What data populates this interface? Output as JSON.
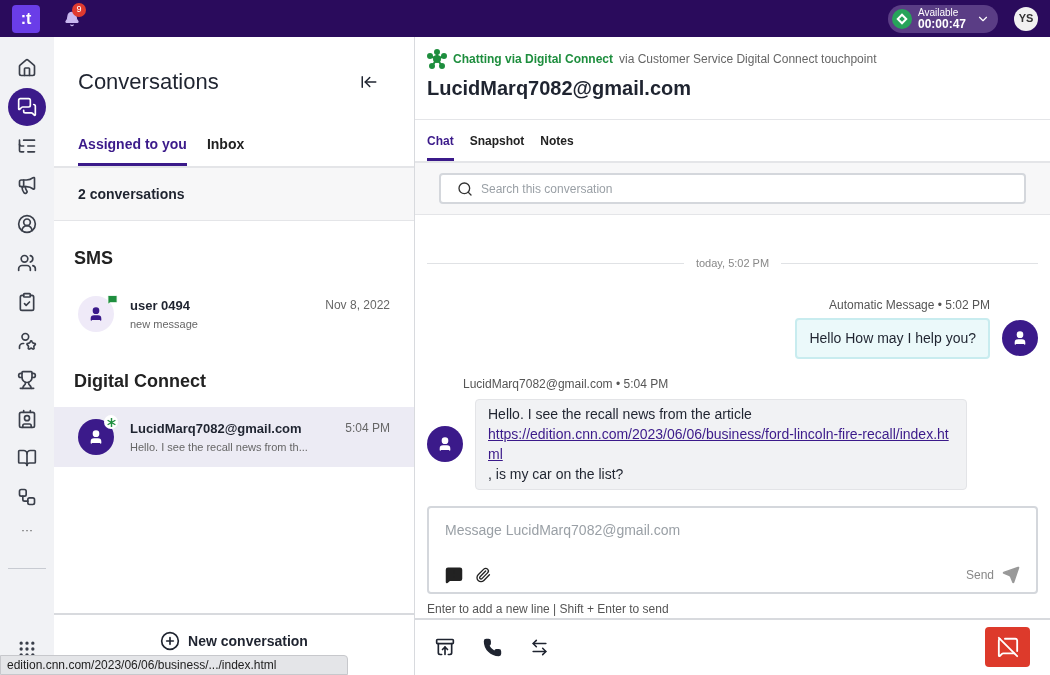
{
  "topbar": {
    "logo": ":t",
    "notifications": "9",
    "status": {
      "label": "Available",
      "timer": "00:00:47"
    },
    "user_initials": "YS"
  },
  "nav": {
    "items": [
      {
        "selected": false
      },
      {
        "selected": true
      },
      {
        "selected": false
      },
      {
        "selected": false
      },
      {
        "selected": false
      },
      {
        "selected": false
      },
      {
        "selected": false
      },
      {
        "selected": false
      },
      {
        "selected": false
      },
      {
        "selected": false
      },
      {
        "selected": false
      },
      {
        "selected": false
      }
    ],
    "more": "···"
  },
  "conversations": {
    "title": "Conversations",
    "tabs": [
      {
        "label": "Assigned to you",
        "selected": true
      },
      {
        "label": "Inbox",
        "selected": false
      }
    ],
    "count": "2 conversations",
    "groups": [
      {
        "title": "SMS",
        "items": [
          {
            "kind": "sms",
            "name": "user 0494",
            "preview": "new message",
            "time": "Nov 8, 2022",
            "selected": false
          }
        ]
      },
      {
        "title": "Digital Connect",
        "items": [
          {
            "kind": "digital",
            "name": "LucidMarq7082@gmail.com",
            "preview": "Hello. I see the recall news from th...",
            "time": "5:04 PM",
            "selected": true
          }
        ]
      }
    ],
    "new_button": "New conversation"
  },
  "chat": {
    "channel": "Chatting via Digital Connect",
    "via": "via Customer Service Digital Connect touchpoint",
    "contact": "LucidMarq7082@gmail.com",
    "tabs": [
      {
        "label": "Chat",
        "selected": true
      },
      {
        "label": "Snapshot",
        "selected": false
      },
      {
        "label": "Notes",
        "selected": false
      }
    ],
    "search": {
      "placeholder": "Search this conversation"
    },
    "divider": "today, 5:02 PM",
    "messages": [
      {
        "kind": "outgoing",
        "meta": "Automatic Message • 5:02 PM",
        "text": "Hello How may I help you?"
      },
      {
        "kind": "incoming",
        "meta": "LucidMarq7082@gmail.com • 5:04 PM",
        "text": "Hello. I see the recall news from the article",
        "link": "https://edition.cnn.com/2023/06/06/business/ford-lincoln-fire-recall/index.html",
        "after": ", is my car on the list?"
      }
    ],
    "composer": {
      "placeholder": "Message LucidMarq7082@gmail.com",
      "send": "Send",
      "hint": "Enter to add a new line | Shift + Enter to send"
    }
  },
  "status_url": "edition.cnn.com/2023/06/06/business/.../index.html"
}
